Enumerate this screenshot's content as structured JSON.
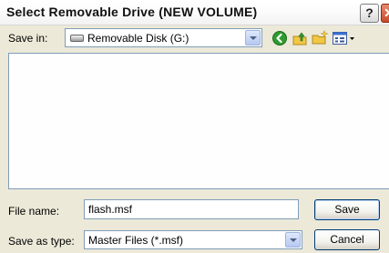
{
  "window": {
    "title": "Select Removable Drive (NEW VOLUME)",
    "help_label": "?",
    "close_label": "✕"
  },
  "toolbar": {
    "save_in_label": "Save in:",
    "save_in_value": "Removable Disk (G:)",
    "icons": [
      "drive-icon",
      "back-icon",
      "up-folder-icon",
      "new-folder-icon",
      "views-menu-icon"
    ]
  },
  "file_list": {
    "items": []
  },
  "form": {
    "file_name_label": "File name:",
    "file_name_value": "flash.msf",
    "save_type_label": "Save as type:",
    "save_type_value": "Master Files (*.msf)"
  },
  "buttons": {
    "save": "Save",
    "cancel": "Cancel"
  },
  "colors": {
    "dialog_bg": "#ece9d8",
    "field_border": "#7f9db9",
    "button_border": "#003c74",
    "back_icon_green": "#2e9b2e",
    "folder_yellow": "#f2c744"
  }
}
